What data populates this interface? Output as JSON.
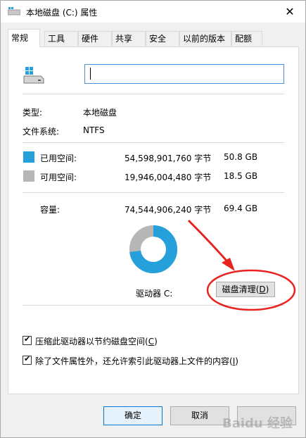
{
  "window": {
    "title": "本地磁盘 (C:) 属性",
    "close_glyph": "✕"
  },
  "tabs": [
    {
      "label": "常规",
      "active": true
    },
    {
      "label": "工具"
    },
    {
      "label": "硬件"
    },
    {
      "label": "共享"
    },
    {
      "label": "安全"
    },
    {
      "label": "以前的版本"
    },
    {
      "label": "配额"
    }
  ],
  "general": {
    "name_value": "",
    "type_label": "类型:",
    "type_value": "本地磁盘",
    "fs_label": "文件系统:",
    "fs_value": "NTFS",
    "used_label": "已用空间:",
    "used_bytes": "54,598,901,760 字节",
    "used_size": "50.8 GB",
    "free_label": "可用空间:",
    "free_bytes": "19,946,004,480 字节",
    "free_size": "18.5 GB",
    "capacity_label": "容量:",
    "capacity_bytes": "74,544,906,240 字节",
    "capacity_size": "69.4 GB",
    "drive_label": "驱动器 C:",
    "cleanup_button": "磁盘清理",
    "cleanup_key": "D",
    "compress_label": "压缩此驱动器以节约磁盘空间",
    "compress_key": "C",
    "compress_checked": true,
    "index_label": "除了文件属性外，还允许索引此驱动器上文件的内容",
    "index_key": "I",
    "index_checked": true
  },
  "colors": {
    "used": "#26a0da",
    "free": "#b6b6b6",
    "annotation": "#e8231f"
  },
  "buttons": {
    "ok": "确定",
    "cancel": "取消"
  },
  "watermark": "Baidu 经验"
}
